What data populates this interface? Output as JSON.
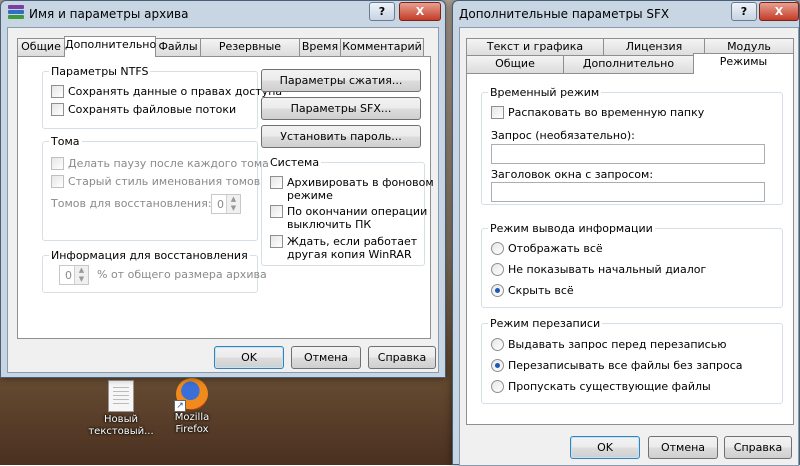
{
  "desktop": {
    "icon1_line1": "Новый",
    "icon1_line2": "текстовый...",
    "icon2_line1": "Mozilla",
    "icon2_line2": "Firefox",
    "shortcut_glyph": "↗"
  },
  "left_window": {
    "title": "Имя и параметры архива",
    "help_btn": "?",
    "close_btn": "X",
    "tabs": [
      "Общие",
      "Дополнительно",
      "Файлы",
      "Резервные копии",
      "Время",
      "Комментарий"
    ],
    "ntfs": {
      "label": "Параметры NTFS",
      "save_security": "Сохранять данные о правах доступа",
      "save_streams": "Сохранять файловые потоки"
    },
    "volumes": {
      "label": "Тома",
      "pause": "Делать паузу после каждого тома",
      "old_style": "Старый стиль именования томов",
      "recovery_label": "Томов для восстановления:",
      "recovery_value": "0"
    },
    "recovery_info": {
      "label": "Информация для восстановления",
      "value": "0",
      "suffix": "% от общего размера архива"
    },
    "buttons": {
      "compression": "Параметры сжатия...",
      "sfx": "Параметры SFX...",
      "password": "Установить пароль..."
    },
    "system": {
      "label": "Система",
      "background_1": "Архивировать в фоновом",
      "background_2": "режиме",
      "shutdown_1": "По окончании операции",
      "shutdown_2": "выключить ПК",
      "wait_1": "Ждать, если работает",
      "wait_2": "другая копия WinRAR"
    },
    "footer": {
      "ok": "OK",
      "cancel": "Отмена",
      "help": "Справка"
    }
  },
  "right_window": {
    "title": "Дополнительные параметры SFX",
    "help_btn": "?",
    "close_btn": "X",
    "tabs_row1": [
      "Текст и графика",
      "Лицензия",
      "Модуль"
    ],
    "tabs_row2": [
      "Общие",
      "Дополнительно",
      "Режимы"
    ],
    "temp_mode": {
      "label": "Временный режим",
      "unpack_temp": "Распаковать во временную папку",
      "request_label": "Запрос (необязательно):",
      "request_value": "",
      "title_label": "Заголовок окна с запросом:",
      "title_value": ""
    },
    "output_mode": {
      "label": "Режим вывода информации",
      "options": [
        "Отображать всё",
        "Не показывать начальный диалог",
        "Скрыть всё"
      ],
      "selected": 2
    },
    "overwrite_mode": {
      "label": "Режим перезаписи",
      "options": [
        "Выдавать запрос перед перезаписью",
        "Перезаписывать все файлы без запроса",
        "Пропускать существующие файлы"
      ],
      "selected": 1
    },
    "footer": {
      "ok": "OK",
      "cancel": "Отмена",
      "help": "Справка"
    }
  },
  "colors": {
    "accent": "#1c58b8",
    "window_frame": "#c8d6e4",
    "close_red": "#c43c28"
  }
}
